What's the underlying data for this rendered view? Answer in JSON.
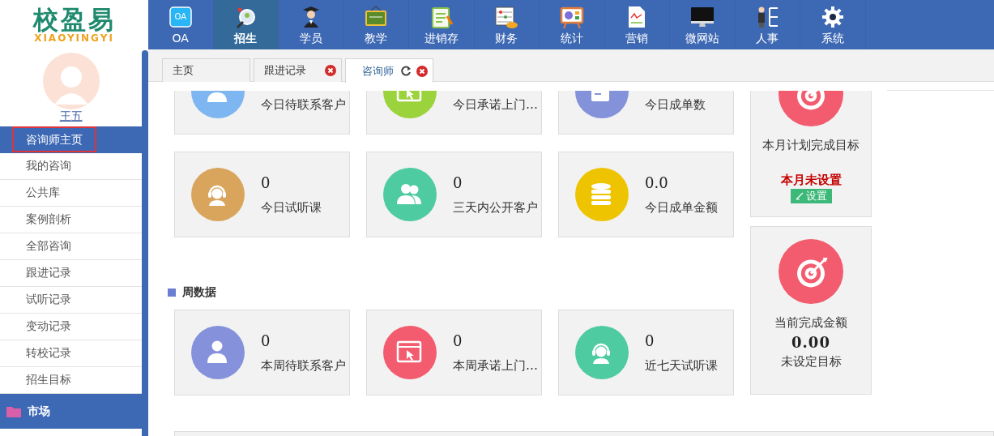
{
  "logo": {
    "name": "校盈易",
    "subtitle": "XIAOYINGYI"
  },
  "user": {
    "name": "王五"
  },
  "nav": [
    {
      "label": "OA",
      "kind": "oa",
      "icon_text": "OA",
      "selected": false
    },
    {
      "label": "招生",
      "kind": "magnifier",
      "selected": true
    },
    {
      "label": "学员",
      "kind": "graduate",
      "selected": false
    },
    {
      "label": "教学",
      "kind": "chalkboard",
      "selected": false
    },
    {
      "label": "进销存",
      "kind": "clipboard",
      "selected": false
    },
    {
      "label": "财务",
      "kind": "abacus",
      "selected": false
    },
    {
      "label": "统计",
      "kind": "easel",
      "selected": false
    },
    {
      "label": "营销",
      "kind": "report",
      "selected": false
    },
    {
      "label": "微网站",
      "kind": "monitor",
      "selected": false
    },
    {
      "label": "人事",
      "kind": "org",
      "selected": false
    },
    {
      "label": "系统",
      "kind": "gear",
      "selected": false
    }
  ],
  "sidebar": {
    "items": [
      {
        "label": "咨询师主页",
        "selected": true
      },
      {
        "label": "我的咨询",
        "selected": false
      },
      {
        "label": "公共库",
        "selected": false
      },
      {
        "label": "案例剖析",
        "selected": false
      },
      {
        "label": "全部咨询",
        "selected": false
      },
      {
        "label": "跟进记录",
        "selected": false
      },
      {
        "label": "试听记录",
        "selected": false
      },
      {
        "label": "变动记录",
        "selected": false
      },
      {
        "label": "转校记录",
        "selected": false
      },
      {
        "label": "招生目标",
        "selected": false
      }
    ],
    "section": {
      "label": "市场"
    }
  },
  "tabs": [
    {
      "label": "主页",
      "selected": false,
      "closable": false,
      "refresh": false
    },
    {
      "label": "跟进记录",
      "selected": false,
      "closable": true,
      "refresh": false
    },
    {
      "label": "咨询师",
      "selected": true,
      "closable": true,
      "refresh": true
    }
  ],
  "today_cards": [
    {
      "label": "今日待联系客户",
      "kind": "person",
      "color": "#7db6f0"
    },
    {
      "label": "今日承诺上门…",
      "kind": "cursor",
      "color": "#9bd33c"
    },
    {
      "label": "今日成单数",
      "kind": "document",
      "color": "#8492d9"
    },
    {
      "value": "0",
      "label": "今日试听课",
      "kind": "headset",
      "color": "#d9a55c"
    },
    {
      "value": "0",
      "label": "三天内公开客户",
      "kind": "people",
      "color": "#4ecba0"
    },
    {
      "value": "0.0",
      "label": "今日成单金额",
      "kind": "coins",
      "color": "#eec400"
    }
  ],
  "week_section": {
    "title": "周数据"
  },
  "week_cards": [
    {
      "value": "0",
      "label": "本周待联系客户",
      "kind": "person",
      "color": "#8591db"
    },
    {
      "value": "0",
      "label": "本周承诺上门…",
      "kind": "cursor",
      "color": "#f25c6e"
    },
    {
      "value": "0",
      "label": "近七天试听课",
      "kind": "headset",
      "color": "#4ecba0"
    }
  ],
  "goal_cards": [
    {
      "title": "本月计划完成目标",
      "status": "本月未设置",
      "button": "设置"
    },
    {
      "title": "当前完成金额",
      "amount": "0.00",
      "note": "未设定目标"
    }
  ]
}
